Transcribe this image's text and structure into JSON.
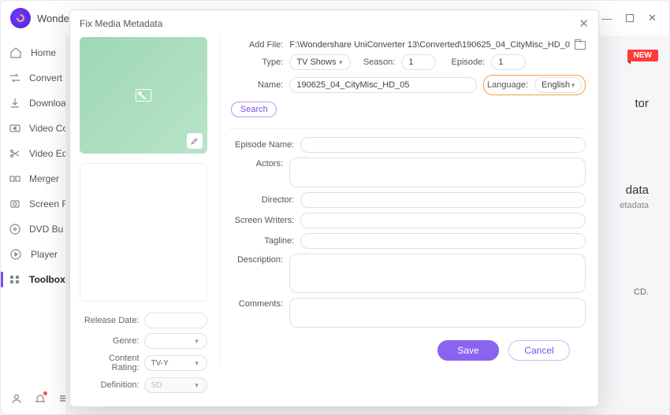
{
  "app": {
    "title": "Wonder"
  },
  "windowControls": {
    "min": "—",
    "close": "✕"
  },
  "sidebar": {
    "items": [
      {
        "label": "Home",
        "icon": "home"
      },
      {
        "label": "Convert",
        "icon": "convert"
      },
      {
        "label": "Downloa",
        "icon": "download"
      },
      {
        "label": "Video Co",
        "icon": "compress"
      },
      {
        "label": "Video Ed",
        "icon": "edit"
      },
      {
        "label": "Merger",
        "icon": "merge"
      },
      {
        "label": "Screen R",
        "icon": "record"
      },
      {
        "label": "DVD Bu",
        "icon": "dvd"
      },
      {
        "label": "Player",
        "icon": "play"
      },
      {
        "label": "Toolbox",
        "icon": "toolbox"
      }
    ]
  },
  "background": {
    "newBadge": "NEW",
    "text1": "tor",
    "text2": "data",
    "text3": "etadata",
    "text4": "CD."
  },
  "modal": {
    "title": "Fix Media Metadata",
    "addFileLabel": "Add File:",
    "addFilePath": "F:\\Wondershare UniConverter 13\\Converted\\190625_04_CityMisc_HD_0",
    "typeLabel": "Type:",
    "typeValue": "TV Shows",
    "seasonLabel": "Season:",
    "seasonValue": "1",
    "episodeLabel": "Episode:",
    "episodeValue": "1",
    "nameLabel": "Name:",
    "nameValue": "190625_04_CityMisc_HD_05",
    "languageLabel": "Language:",
    "languageValue": "English",
    "searchBtn": "Search",
    "episodeNameLabel": "Episode Name:",
    "actorsLabel": "Actors:",
    "directorLabel": "Director:",
    "screenWritersLabel": "Screen Writers:",
    "taglineLabel": "Tagline:",
    "descriptionLabel": "Description:",
    "commentsLabel": "Comments:",
    "leftFields": {
      "releaseDateLabel": "Release Date:",
      "genreLabel": "Genre:",
      "contentRatingLabel": "Content Rating:",
      "contentRatingValue": "TV-Y",
      "definitionLabel": "Definition:",
      "definitionValue": "SD"
    },
    "saveBtn": "Save",
    "cancelBtn": "Cancel"
  }
}
